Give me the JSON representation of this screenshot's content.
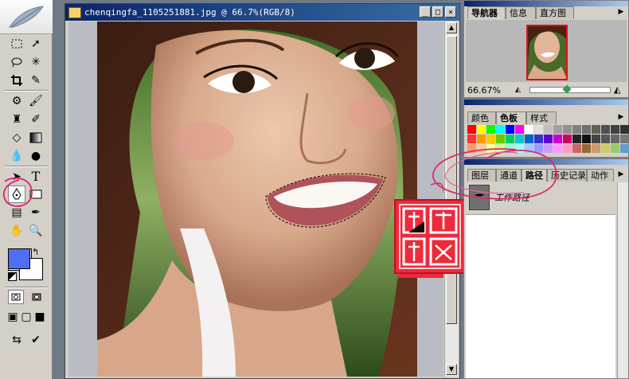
{
  "document": {
    "title": "chenqingfa_1105251881.jpg @ 66.7%(RGB/8)",
    "min_label": "_",
    "max_label": "□",
    "close_label": "×"
  },
  "navigator": {
    "tabs": [
      "导航器",
      "信息",
      "直方图"
    ],
    "zoom": "66.67%"
  },
  "color_panel": {
    "tabs": [
      "颜色",
      "色板",
      "样式"
    ],
    "swatches": [
      "#ff0000",
      "#ffff00",
      "#00ff00",
      "#00ffff",
      "#0000ff",
      "#ff00ff",
      "#ffffff",
      "#e0e0e0",
      "#c0c0c0",
      "#a0a0a0",
      "#909090",
      "#808080",
      "#707070",
      "#606050",
      "#505050",
      "#404040",
      "#303030",
      "#ff3333",
      "#ff9900",
      "#ffcc00",
      "#66cc00",
      "#00cc66",
      "#00cccc",
      "#0066cc",
      "#3333cc",
      "#6600cc",
      "#cc00cc",
      "#cc0066",
      "#222222",
      "#111111",
      "#444444",
      "#555555",
      "#666666",
      "#777777",
      "#ff9966",
      "#ffcc99",
      "#ffff99",
      "#ccff99",
      "#99ffcc",
      "#99ffff",
      "#99ccff",
      "#9999ff",
      "#cc99ff",
      "#ff99ff",
      "#ff99cc",
      "#cc6666",
      "#996633",
      "#cc9966",
      "#cccc66",
      "#99cc66",
      "#6699cc"
    ]
  },
  "layers_panel": {
    "tabs": [
      "图层",
      "通道",
      "路径",
      "历史记录",
      "动作"
    ],
    "path_name": "工作路径"
  },
  "tools": {
    "text_tool_label": "T"
  },
  "stamp": {
    "chars": [
      "陈",
      "庆",
      "法",
      "印"
    ]
  }
}
